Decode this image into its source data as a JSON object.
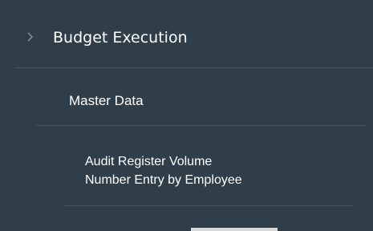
{
  "nav": {
    "level1": {
      "label": "Budget Execution",
      "icon": "chevron-right-icon"
    },
    "level2": {
      "label": "Master Data"
    },
    "level3": {
      "line1": "Audit Register Volume",
      "line2": "Number Entry by Employee"
    }
  },
  "colors": {
    "background": "#2f3e48",
    "divider": "#46555f",
    "text": "#ffffff",
    "chevron": "#7f8b93"
  }
}
